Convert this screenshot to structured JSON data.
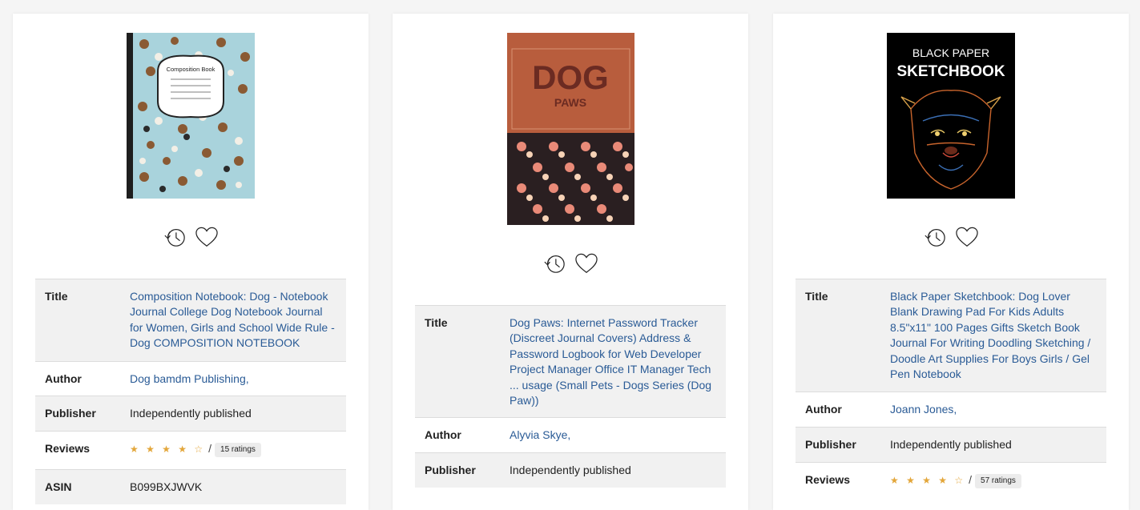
{
  "cards": [
    {
      "cover": {
        "icon": "notebook-cover-dog-pattern",
        "text": "Composition Book"
      },
      "title": "Composition Notebook: Dog - Notebook Journal College Dog Notebook Journal for Women, Girls and School Wide Rule - Dog COMPOSITION NOTEBOOK",
      "author": "Dog bamdm Publishing,",
      "publisher": "Independently published",
      "reviews_count": "15 ratings",
      "rating": 4.5,
      "asin": "B099BXJWVK"
    },
    {
      "cover": {
        "icon": "dog-paws-cover",
        "big": "DOG",
        "small": "PAWS"
      },
      "title": "Dog Paws: Internet Password Tracker (Discreet Journal Covers) Address & Password Logbook for Web Developer Project Manager Office IT Manager Tech ... usage (Small Pets - Dogs Series (Dog Paw))",
      "author": "Alyvia Skye,",
      "publisher": "Independently published"
    },
    {
      "cover": {
        "icon": "black-sketchbook-dog-cover",
        "line1": "BLACK PAPER",
        "line2": "SKETCHBOOK"
      },
      "title": "Black Paper Sketchbook: Dog Lover Blank Drawing Pad For Kids Adults 8.5\"x11\" 100 Pages Gifts Sketch Book Journal For Writing Doodling Sketching / Doodle Art Supplies For Boys Girls / Gel Pen Notebook",
      "author": "Joann Jones,",
      "publisher": "Independently published",
      "reviews_count": "57 ratings",
      "rating": 4.5
    }
  ],
  "labels": {
    "title": "Title",
    "author": "Author",
    "publisher": "Publisher",
    "reviews": "Reviews",
    "asin": "ASIN",
    "slash": "/",
    "stars": "★ ★ ★ ★ ☆"
  },
  "colors": {
    "link": "#2a5b96",
    "star": "#e3a63a",
    "row_shade": "#f1f1f1"
  }
}
